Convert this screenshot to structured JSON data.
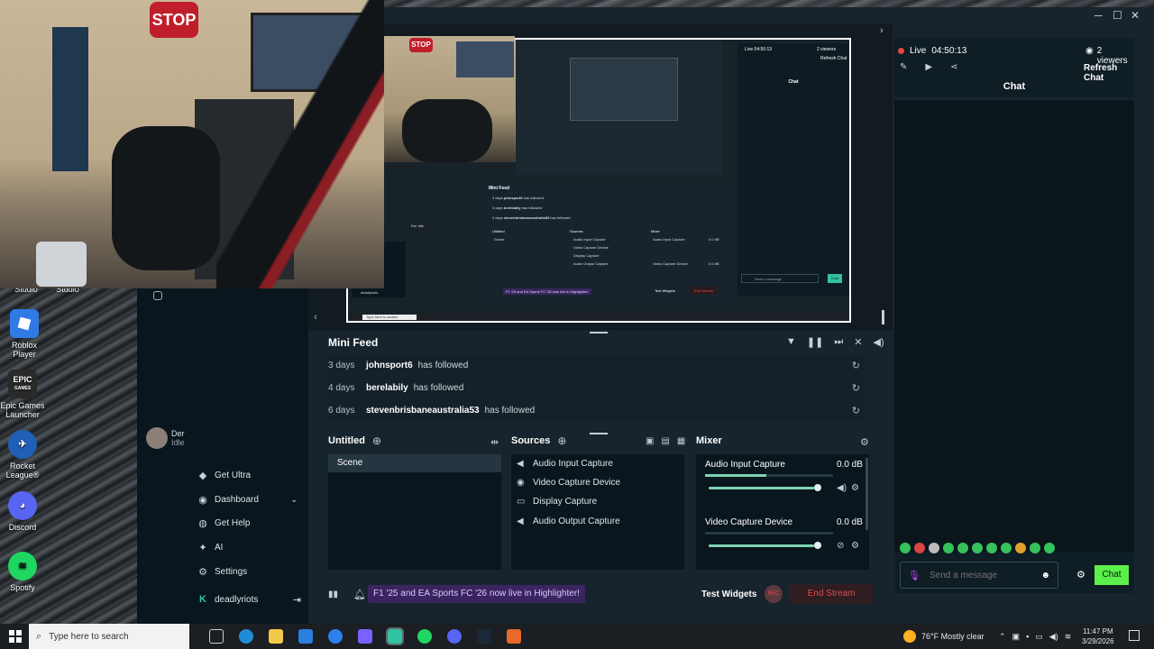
{
  "desktop": {
    "icons": [
      {
        "label": "Studio"
      },
      {
        "label": "Studio"
      },
      {
        "label": "Roblox Player"
      },
      {
        "label": "Epic Games Launcher"
      },
      {
        "label": "Rocket League®"
      },
      {
        "label": "Discord"
      },
      {
        "label": "Spotify"
      }
    ],
    "epic_logo_text": "EPIC",
    "epic_logo_sub": "GAMES"
  },
  "webcam": {
    "stop_sign": "STOP"
  },
  "preview": {
    "mini_feed_title": "Mini Feed",
    "rows": [
      {
        "days": "3 days",
        "name": "johnsport6",
        "msg": "has followed"
      },
      {
        "days": "3 days",
        "name": "berelabily",
        "msg": "has followed"
      },
      {
        "days": "4 days",
        "name": "stevenbrisbaneaustralia53",
        "msg": "has followed"
      }
    ],
    "scenes_title": "Untitled",
    "scene_item": "Scene",
    "sources_title": "Sources",
    "mixer_title": "Mixer",
    "sources": [
      "Audio Input Capture",
      "Video Capture Device",
      "Display Capture",
      "Audio Output Capture"
    ],
    "mixer": [
      "Audio Input Capture",
      "Video Capture Device"
    ],
    "mixer_db": "0.0 dB",
    "test_widgets": "Test Widgets",
    "end_stream": "End Stream",
    "banner": "F1 '25 and EA Sports FC '26 now live in Highlighter!",
    "live_text": "Live 04:50:13",
    "viewers": "2 viewers",
    "refresh_chat": "Refresh Chat",
    "chat_title": "Chat",
    "send_placeholder": "Send a message",
    "chat_button": "Chat",
    "search": "Type here to search",
    "sidebar": [
      "Get Ultra",
      "Dashboard",
      "Get Help",
      "AI",
      "Settings",
      "deadlyriots"
    ],
    "user": {
      "name": "Der",
      "status": "Idle"
    }
  },
  "app": {
    "window_controls": [
      "─",
      "☐",
      "✕"
    ],
    "live": {
      "label": "Live",
      "time": "04:50:13"
    },
    "viewers": "2 viewers",
    "refresh_chat": "Refresh Chat",
    "chat_title": "Chat",
    "chat_input_placeholder": "Send a message",
    "chat_button": "Chat",
    "user": {
      "name": "Der",
      "status": "Idle"
    },
    "sidebar": [
      {
        "label": "Get Ultra",
        "icon": "ultra-icon"
      },
      {
        "label": "Dashboard",
        "icon": "dashboard-icon"
      },
      {
        "label": "Get Help",
        "icon": "help-icon"
      },
      {
        "label": "AI",
        "icon": "ai-icon"
      },
      {
        "label": "Settings",
        "icon": "gear-icon"
      }
    ],
    "account": {
      "name": "deadlyriots"
    },
    "mini_feed": {
      "title": "Mini Feed",
      "rows": [
        {
          "days": "3 days",
          "name": "johnsport6",
          "msg": "has followed"
        },
        {
          "days": "4 days",
          "name": "berelabily",
          "msg": "has followed"
        },
        {
          "days": "6 days",
          "name": "stevenbrisbaneaustralia53",
          "msg": "has followed"
        }
      ]
    },
    "scenes": {
      "title": "Untitled",
      "items": [
        "Scene"
      ]
    },
    "sources": {
      "title": "Sources",
      "items": [
        {
          "label": "Audio Input Capture",
          "icon": "speaker-icon"
        },
        {
          "label": "Video Capture Device",
          "icon": "camera-icon"
        },
        {
          "label": "Display Capture",
          "icon": "monitor-icon"
        },
        {
          "label": "Audio Output Capture",
          "icon": "speaker-icon"
        }
      ]
    },
    "mixer": {
      "title": "Mixer",
      "items": [
        {
          "label": "Audio Input Capture",
          "db": "0.0 dB",
          "level": 0.96
        },
        {
          "label": "Video Capture Device",
          "db": "0.0 dB",
          "level": 0.96
        }
      ]
    },
    "status": {
      "banner": "F1 '25 and EA Sports FC '26 now live in Highlighter!",
      "test_widgets": "Test Widgets",
      "rec": "REC",
      "end_stream": "End Stream"
    }
  },
  "taskbar": {
    "search_placeholder": "Type here to search",
    "weather": "76°F  Mostly clear",
    "time": "11:47 PM",
    "date": "3/29/2026"
  },
  "colors": {
    "accent": "#31c3a2",
    "live": "#e4473d",
    "end_stream": "#e24b4b",
    "banner": "#3a2560"
  }
}
